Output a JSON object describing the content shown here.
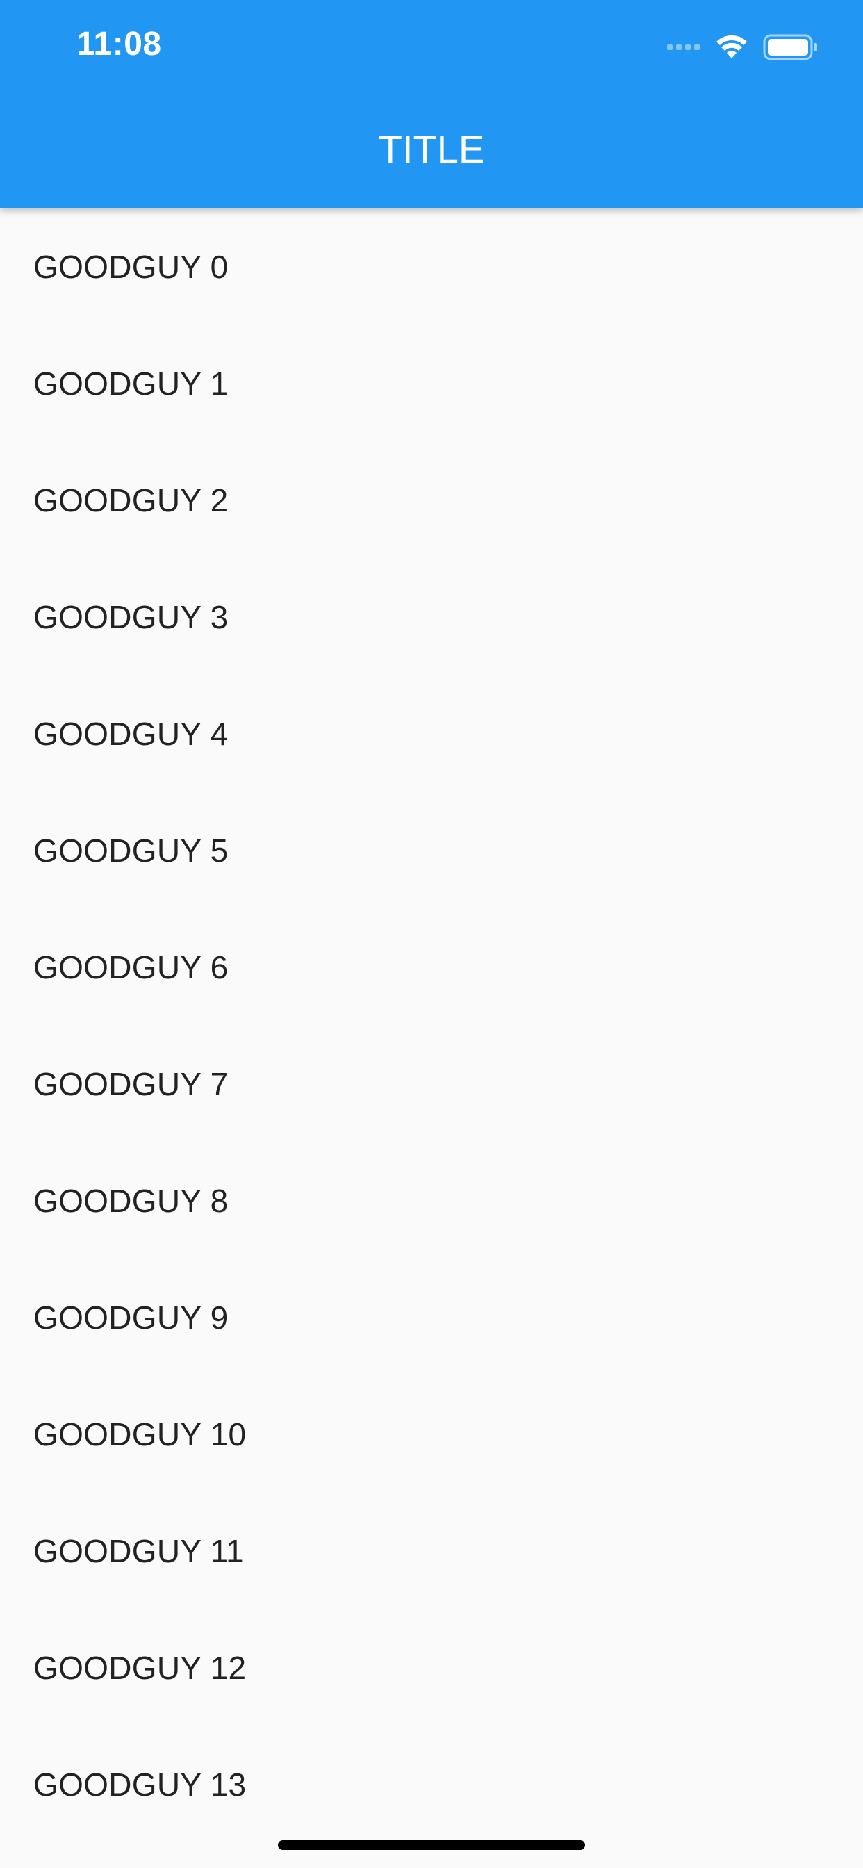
{
  "status_bar": {
    "time": "11:08",
    "icons": [
      "signal-icon",
      "wifi-icon",
      "battery-icon"
    ]
  },
  "app_bar": {
    "title": "TITLE",
    "color": "#2196f3"
  },
  "list": {
    "items": [
      {
        "label": "GOODGUY 0"
      },
      {
        "label": "GOODGUY 1"
      },
      {
        "label": "GOODGUY 2"
      },
      {
        "label": "GOODGUY 3"
      },
      {
        "label": "GOODGUY 4"
      },
      {
        "label": "GOODGUY 5"
      },
      {
        "label": "GOODGUY 6"
      },
      {
        "label": "GOODGUY 7"
      },
      {
        "label": "GOODGUY 8"
      },
      {
        "label": "GOODGUY 9"
      },
      {
        "label": "GOODGUY 10"
      },
      {
        "label": "GOODGUY 11"
      },
      {
        "label": "GOODGUY 12"
      },
      {
        "label": "GOODGUY 13"
      }
    ]
  }
}
